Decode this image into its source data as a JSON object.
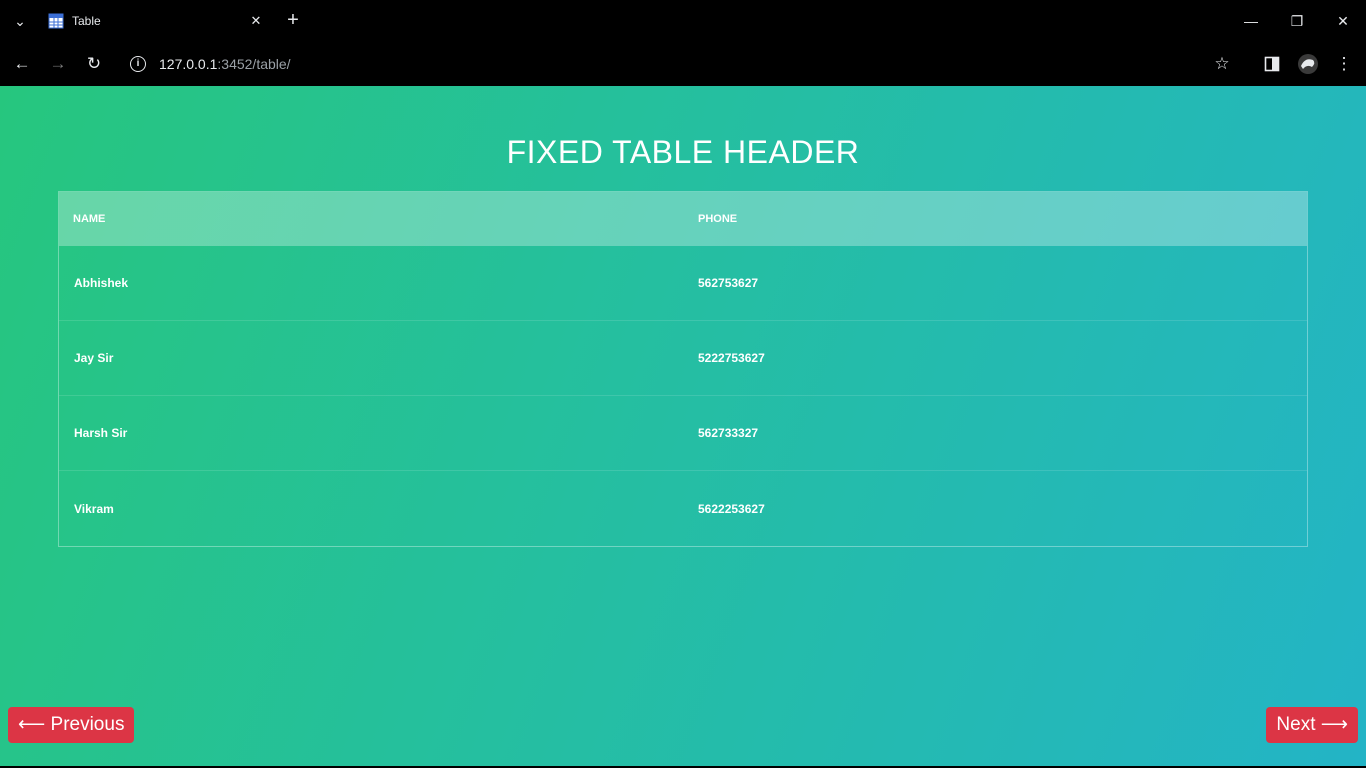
{
  "browser": {
    "tab_title": "Table",
    "url_host": "127.0.0.1",
    "url_rest": ":3452/table/",
    "icons": {
      "tab_list": "chevron-down-icon",
      "close_tab": "close-icon",
      "new_tab": "plus-icon",
      "back": "arrow-left-icon",
      "forward": "arrow-right-icon",
      "reload": "reload-icon",
      "info": "info-icon",
      "bookmark": "star-icon",
      "side_panel": "side-panel-icon",
      "profile": "avatar-icon",
      "menu": "kebab-menu-icon"
    }
  },
  "page": {
    "title": "FIXED TABLE HEADER",
    "table": {
      "headers": [
        "NAME",
        "PHONE"
      ],
      "rows": [
        {
          "name": "Abhishek",
          "phone": "562753627"
        },
        {
          "name": "Jay Sir",
          "phone": "5222753627"
        },
        {
          "name": "Harsh Sir",
          "phone": "562733327"
        },
        {
          "name": "Vikram",
          "phone": "5622253627"
        }
      ]
    },
    "prev_label": "⟵ Previous",
    "next_label": "Next ⟶",
    "colors": {
      "gradient_start": "#26c67e",
      "gradient_end": "#23b4c6",
      "button": "#dc3545"
    }
  }
}
